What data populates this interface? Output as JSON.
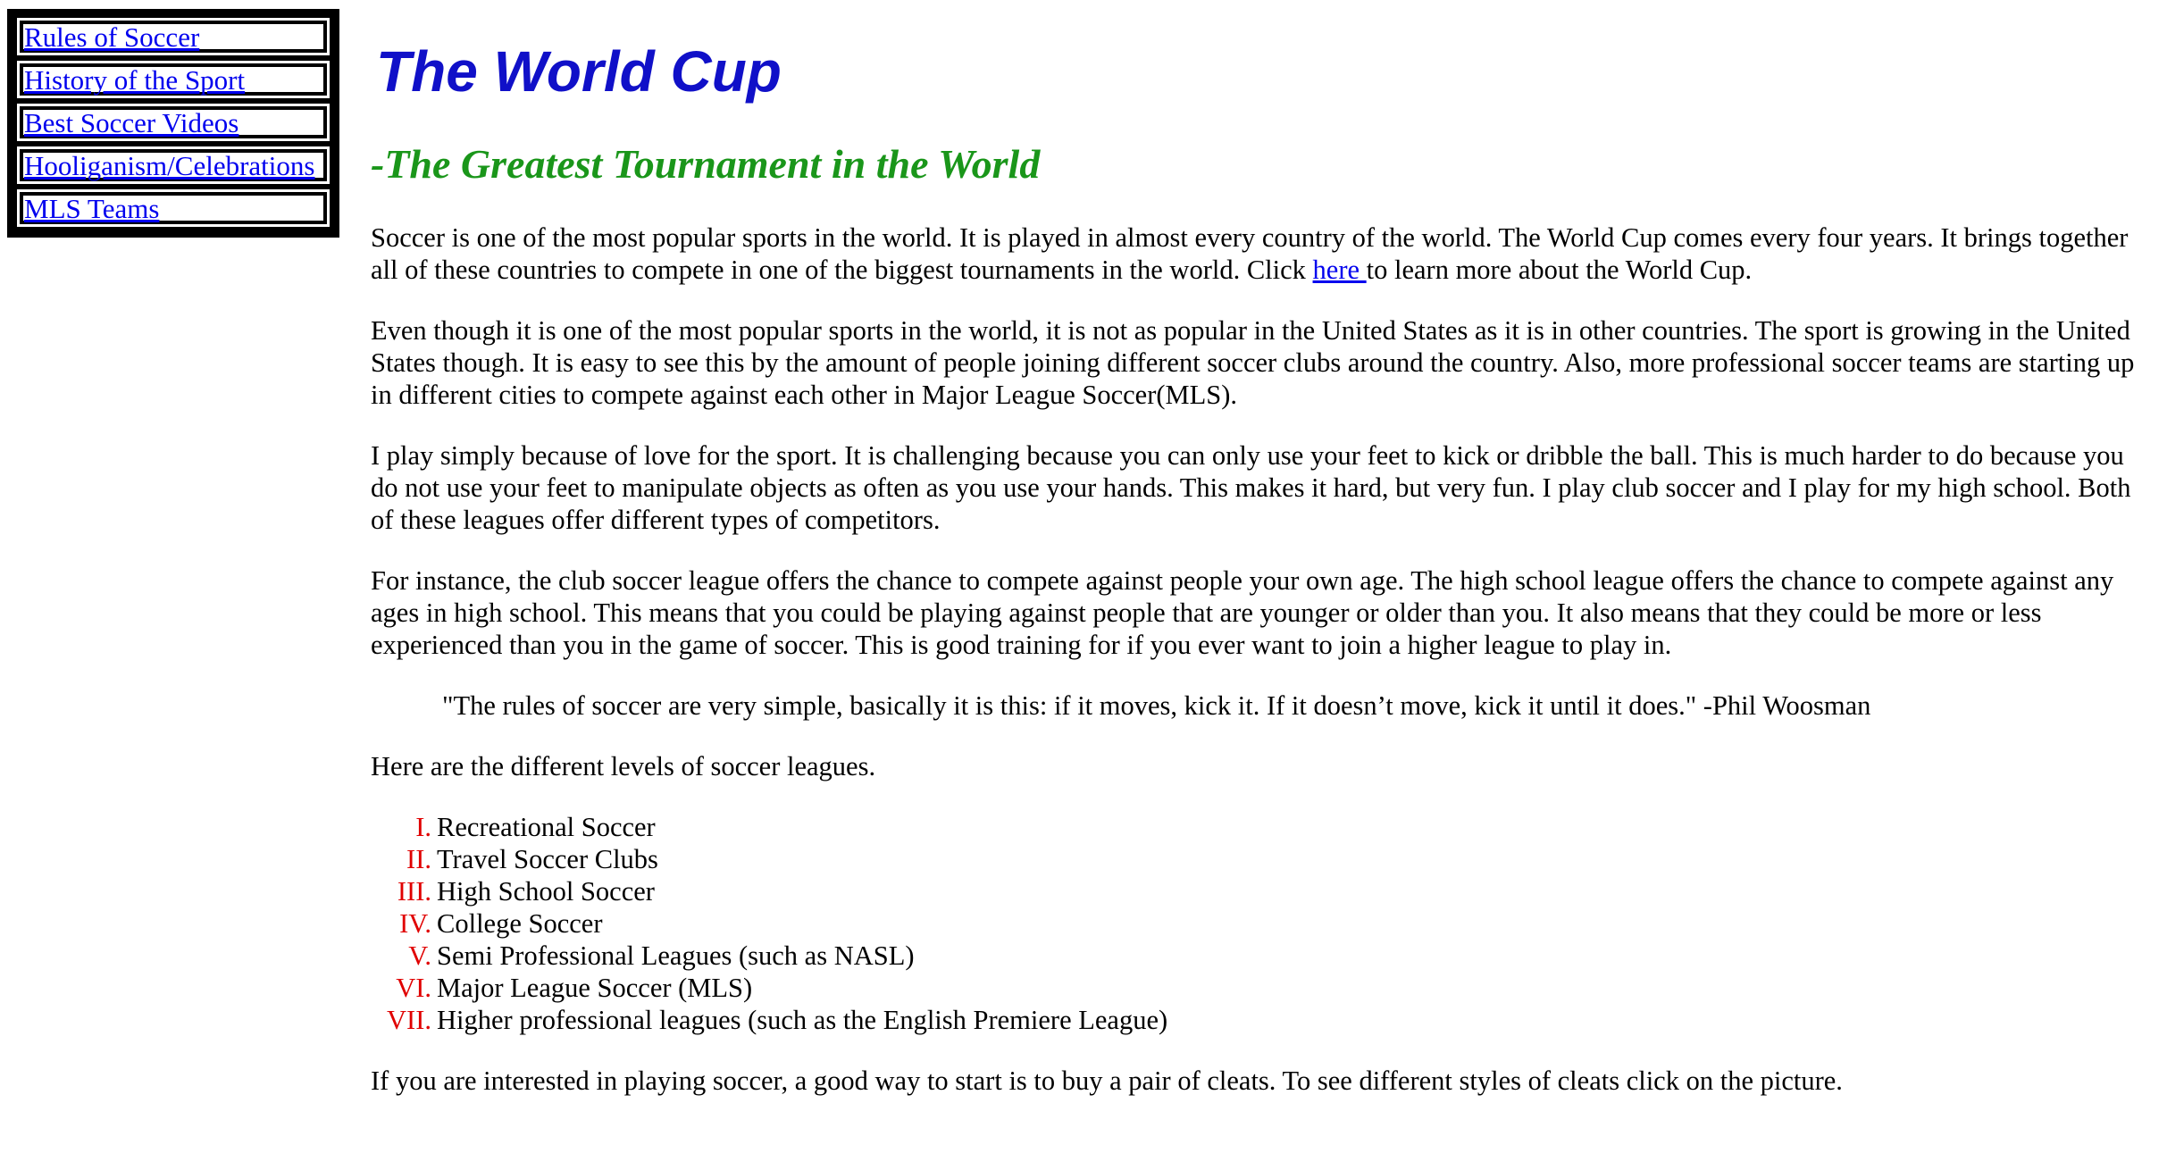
{
  "nav": {
    "items": [
      {
        "label": "Rules of Soccer"
      },
      {
        "label": "History of the Sport"
      },
      {
        "label": "Best Soccer Videos"
      },
      {
        "label": "Hooliganism/Celebrations"
      },
      {
        "label": "MLS Teams"
      }
    ]
  },
  "header": {
    "title": "The World Cup",
    "subtitle": "-The Greatest Tournament in the World"
  },
  "content": {
    "p1_before": "Soccer is one of the most popular sports in the world. It is played in almost every country of the world. The World Cup comes every four years. It brings together all of these countries to compete in one of the biggest tournaments in the world. Click ",
    "p1_link": "here ",
    "p1_after": "to learn more about the World Cup.",
    "p2": "Even though it is one of the most popular sports in the world, it is not as popular in the United States as it is in other countries. The sport is growing in the United States though. It is easy to see this by the amount of people joining different soccer clubs around the country. Also, more professional soccer teams are starting up in different cities to compete against each other in Major League Soccer(MLS).",
    "p3": "I play simply because of love for the sport. It is challenging because you can only use your feet to kick or dribble the ball. This is much harder to do because you do not use your feet to manipulate objects as often as you use your hands. This makes it hard, but very fun. I play club soccer and I play for my high school. Both of these leagues offer different types of competitors.",
    "p4": "For instance, the club soccer league offers the chance to compete against people your own age. The high school league offers the chance to compete against any ages in high school. This means that you could be playing against people that are younger or older than you. It also means that they could be more or less experienced than you in the game of soccer. This is good training for if you ever want to join a higher league to play in.",
    "quote": "\"The rules of soccer are very simple, basically it is this: if it moves, kick it. If it doesn’t move, kick it until it does.\" -Phil Woosman",
    "p5": "Here are the different levels of soccer leagues.",
    "levels": [
      {
        "numeral": "I.",
        "label": "Recreational Soccer"
      },
      {
        "numeral": "II.",
        "label": "Travel Soccer Clubs"
      },
      {
        "numeral": "III.",
        "label": "High School Soccer"
      },
      {
        "numeral": "IV.",
        "label": "College Soccer"
      },
      {
        "numeral": "V.",
        "label": "Semi Professional Leagues (such as NASL)"
      },
      {
        "numeral": "VI.",
        "label": "Major League Soccer (MLS)"
      },
      {
        "numeral": "VII.",
        "label": "Higher professional leagues (such as the English Premiere League)"
      }
    ],
    "p6": "If you are interested in playing soccer, a good way to start is to buy a pair of cleats. To see different styles of cleats click on the picture."
  },
  "colors": {
    "link": "#0000EE",
    "title": "#1010C8",
    "subtitle": "#1A961A",
    "numeral": "#E00000"
  }
}
